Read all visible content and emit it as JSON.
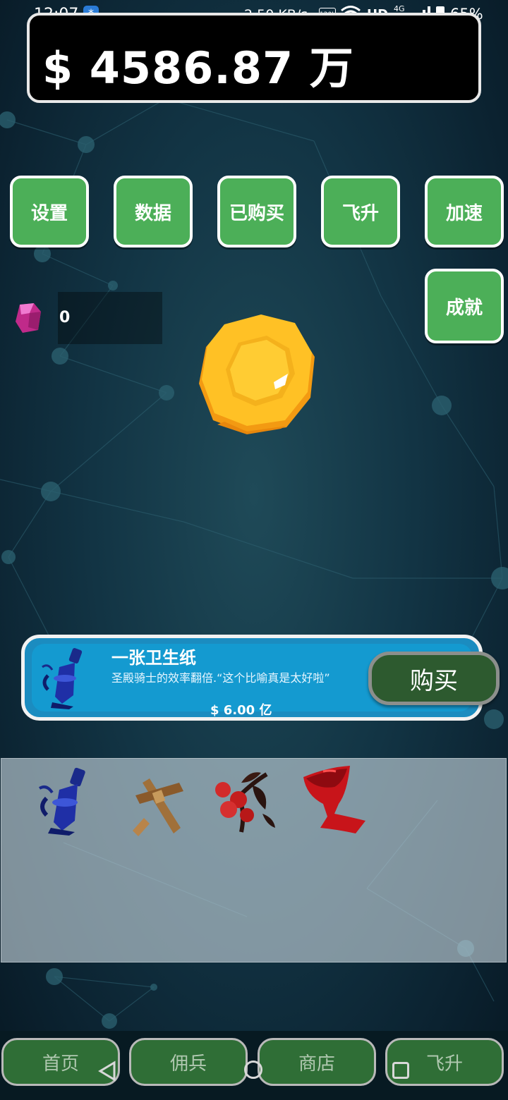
{
  "status_bar": {
    "time": "12:07",
    "speed": "2.50 KB/s",
    "hz": "120Hz",
    "hd": "HD",
    "network": "4G",
    "battery": "65%"
  },
  "money": {
    "amount": "$ 4586.87 万"
  },
  "top_buttons": {
    "settings": "设置",
    "data": "数据",
    "purchased": "已购买",
    "ascend": "飞升",
    "speedup": "加速",
    "achievements": "成就"
  },
  "gems": {
    "count": "0"
  },
  "upgrade_card": {
    "title": "一张卫生纸",
    "description": "圣殿骑士的效率翻倍.“这个比喻真是太好啦”",
    "price": "$ 6.00 亿",
    "buy_label": "购买",
    "icon": "blue-lantern-icon"
  },
  "inventory": {
    "items": [
      {
        "icon": "blue-lantern-icon"
      },
      {
        "icon": "wooden-cross-icon"
      },
      {
        "icon": "red-berries-icon"
      },
      {
        "icon": "red-goblet-icon"
      }
    ]
  },
  "bottom_nav": {
    "home": "首页",
    "mercenary": "佣兵",
    "shop": "商店",
    "ascend": "飞升"
  },
  "colors": {
    "button_green": "#4caf58",
    "card_blue": "#149ad0",
    "buy_green": "#2d5a2f",
    "nav_green": "#2f6e36"
  }
}
